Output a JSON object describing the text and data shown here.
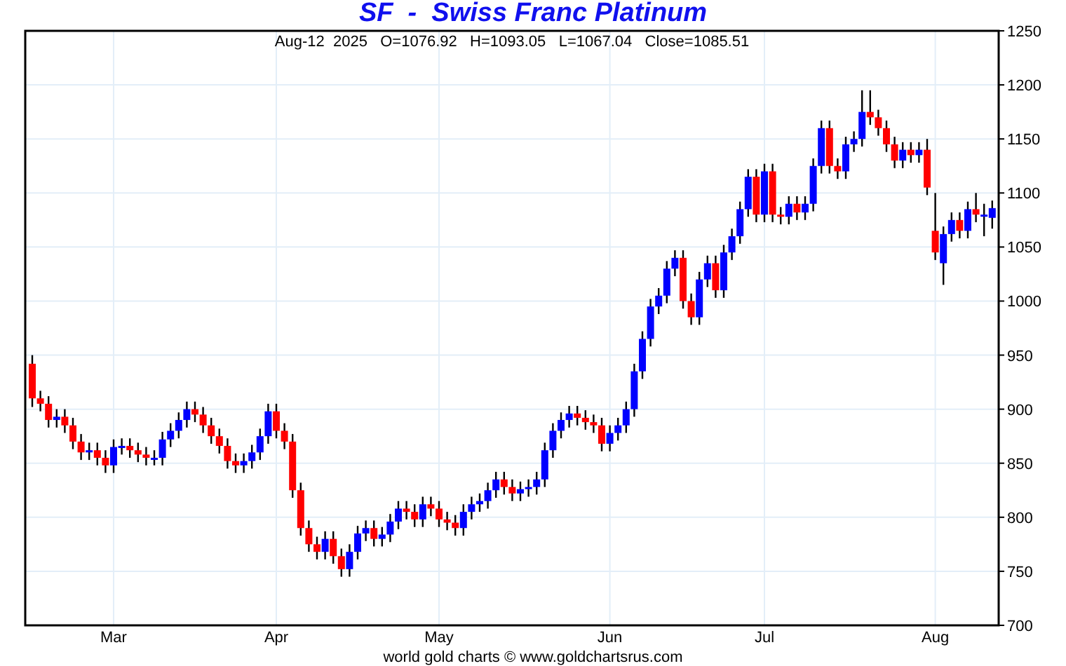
{
  "chart_title": "SF  -  Swiss Franc Platinum",
  "quote_line": "Aug-12  2025   O=1076.92   H=1093.05   L=1067.04   Close=1085.51",
  "chart_data": {
    "type": "candlestick",
    "grid": true,
    "ylim": [
      700,
      1250
    ],
    "yticks": [
      700,
      750,
      800,
      850,
      900,
      950,
      1000,
      1050,
      1100,
      1150,
      1200,
      1250
    ],
    "categories": [
      null,
      null,
      null,
      null,
      null,
      null,
      null,
      null,
      null,
      null,
      "Mar",
      null,
      null,
      null,
      null,
      null,
      null,
      null,
      null,
      null,
      null,
      null,
      null,
      null,
      null,
      null,
      null,
      null,
      null,
      null,
      "Apr",
      null,
      null,
      null,
      null,
      null,
      null,
      null,
      null,
      null,
      null,
      null,
      null,
      null,
      null,
      null,
      null,
      null,
      null,
      null,
      "May",
      null,
      null,
      null,
      null,
      null,
      null,
      null,
      null,
      null,
      null,
      null,
      null,
      null,
      null,
      null,
      null,
      null,
      null,
      null,
      null,
      "Jun",
      null,
      null,
      null,
      null,
      null,
      null,
      null,
      null,
      null,
      null,
      null,
      null,
      null,
      null,
      null,
      null,
      null,
      null,
      "Jul",
      null,
      null,
      null,
      null,
      null,
      null,
      null,
      null,
      null,
      null,
      null,
      null,
      null,
      null,
      null,
      null,
      null,
      null,
      null,
      null,
      "Aug",
      null,
      null,
      null,
      null,
      null,
      null,
      null
    ],
    "ohlc": [
      [
        942,
        950,
        902,
        910
      ],
      [
        910,
        917,
        898,
        905
      ],
      [
        905,
        912,
        883,
        890
      ],
      [
        890,
        900,
        883,
        893
      ],
      [
        893,
        900,
        878,
        885
      ],
      [
        885,
        892,
        863,
        870
      ],
      [
        870,
        877,
        853,
        860
      ],
      [
        860,
        869,
        853,
        862
      ],
      [
        862,
        869,
        848,
        855
      ],
      [
        855,
        862,
        841,
        848
      ],
      [
        848,
        872,
        841,
        865
      ],
      [
        865,
        873,
        858,
        866
      ],
      [
        866,
        873,
        855,
        862
      ],
      [
        862,
        869,
        851,
        858
      ],
      [
        858,
        865,
        848,
        855
      ],
      [
        855,
        862,
        848,
        855
      ],
      [
        855,
        879,
        848,
        872
      ],
      [
        872,
        887,
        865,
        880
      ],
      [
        880,
        897,
        873,
        890
      ],
      [
        890,
        907,
        883,
        900
      ],
      [
        900,
        907,
        888,
        895
      ],
      [
        895,
        902,
        878,
        885
      ],
      [
        885,
        892,
        868,
        875
      ],
      [
        875,
        882,
        859,
        866
      ],
      [
        866,
        873,
        845,
        852
      ],
      [
        852,
        859,
        841,
        848
      ],
      [
        848,
        859,
        841,
        852
      ],
      [
        852,
        867,
        845,
        860
      ],
      [
        860,
        882,
        853,
        875
      ],
      [
        875,
        905,
        868,
        898
      ],
      [
        898,
        905,
        873,
        880
      ],
      [
        880,
        887,
        863,
        870
      ],
      [
        870,
        877,
        818,
        825
      ],
      [
        825,
        832,
        783,
        790
      ],
      [
        790,
        797,
        768,
        775
      ],
      [
        775,
        782,
        761,
        768
      ],
      [
        768,
        787,
        761,
        780
      ],
      [
        780,
        787,
        757,
        764
      ],
      [
        764,
        771,
        745,
        752
      ],
      [
        752,
        775,
        745,
        768
      ],
      [
        768,
        792,
        761,
        785
      ],
      [
        785,
        797,
        778,
        790
      ],
      [
        790,
        797,
        773,
        780
      ],
      [
        780,
        791,
        773,
        784
      ],
      [
        784,
        803,
        777,
        796
      ],
      [
        796,
        815,
        789,
        808
      ],
      [
        808,
        815,
        798,
        805
      ],
      [
        805,
        812,
        791,
        798
      ],
      [
        798,
        819,
        791,
        812
      ],
      [
        812,
        819,
        801,
        808
      ],
      [
        808,
        815,
        791,
        798
      ],
      [
        798,
        805,
        788,
        795
      ],
      [
        795,
        802,
        783,
        790
      ],
      [
        790,
        812,
        783,
        805
      ],
      [
        805,
        819,
        798,
        812
      ],
      [
        812,
        822,
        805,
        815
      ],
      [
        815,
        832,
        808,
        825
      ],
      [
        825,
        842,
        818,
        835
      ],
      [
        835,
        842,
        821,
        828
      ],
      [
        828,
        835,
        815,
        822
      ],
      [
        822,
        833,
        815,
        826
      ],
      [
        826,
        835,
        819,
        828
      ],
      [
        828,
        842,
        821,
        835
      ],
      [
        835,
        869,
        828,
        862
      ],
      [
        862,
        887,
        855,
        880
      ],
      [
        880,
        897,
        873,
        890
      ],
      [
        890,
        903,
        883,
        896
      ],
      [
        896,
        903,
        885,
        892
      ],
      [
        892,
        899,
        881,
        888
      ],
      [
        888,
        895,
        878,
        885
      ],
      [
        885,
        892,
        861,
        868
      ],
      [
        868,
        885,
        861,
        878
      ],
      [
        878,
        892,
        871,
        885
      ],
      [
        885,
        907,
        878,
        900
      ],
      [
        900,
        942,
        893,
        935
      ],
      [
        935,
        972,
        928,
        965
      ],
      [
        965,
        1002,
        958,
        995
      ],
      [
        995,
        1012,
        988,
        1005
      ],
      [
        1005,
        1037,
        998,
        1030
      ],
      [
        1030,
        1047,
        1023,
        1040
      ],
      [
        1040,
        1047,
        993,
        1000
      ],
      [
        1000,
        1007,
        978,
        985
      ],
      [
        985,
        1027,
        978,
        1020
      ],
      [
        1020,
        1042,
        1013,
        1035
      ],
      [
        1035,
        1042,
        1003,
        1010
      ],
      [
        1010,
        1052,
        1003,
        1045
      ],
      [
        1045,
        1067,
        1038,
        1060
      ],
      [
        1060,
        1092,
        1053,
        1085
      ],
      [
        1085,
        1122,
        1078,
        1115
      ],
      [
        1115,
        1122,
        1073,
        1080
      ],
      [
        1080,
        1127,
        1073,
        1120
      ],
      [
        1120,
        1127,
        1073,
        1080
      ],
      [
        1080,
        1087,
        1071,
        1078
      ],
      [
        1078,
        1097,
        1071,
        1090
      ],
      [
        1090,
        1097,
        1075,
        1082
      ],
      [
        1082,
        1097,
        1075,
        1090
      ],
      [
        1090,
        1132,
        1083,
        1125
      ],
      [
        1125,
        1167,
        1118,
        1160
      ],
      [
        1160,
        1167,
        1118,
        1125
      ],
      [
        1125,
        1132,
        1113,
        1120
      ],
      [
        1120,
        1152,
        1113,
        1145
      ],
      [
        1145,
        1157,
        1138,
        1150
      ],
      [
        1150,
        1195,
        1143,
        1175
      ],
      [
        1175,
        1195,
        1163,
        1170
      ],
      [
        1170,
        1177,
        1153,
        1160
      ],
      [
        1160,
        1167,
        1138,
        1145
      ],
      [
        1145,
        1152,
        1123,
        1130
      ],
      [
        1130,
        1147,
        1123,
        1140
      ],
      [
        1140,
        1147,
        1128,
        1135
      ],
      [
        1135,
        1147,
        1128,
        1140
      ],
      [
        1140,
        1150,
        1098,
        1105
      ],
      [
        1065,
        1100,
        1038,
        1045
      ],
      [
        1035,
        1069,
        1015,
        1062
      ],
      [
        1062,
        1082,
        1055,
        1075
      ],
      [
        1075,
        1082,
        1058,
        1065
      ],
      [
        1065,
        1092,
        1058,
        1085
      ],
      [
        1085,
        1100,
        1073,
        1080
      ],
      [
        1080,
        1090,
        1060,
        1080
      ],
      [
        1077,
        1093,
        1067,
        1086
      ]
    ]
  },
  "footer": "world gold charts © www.goldchartsrus.com"
}
